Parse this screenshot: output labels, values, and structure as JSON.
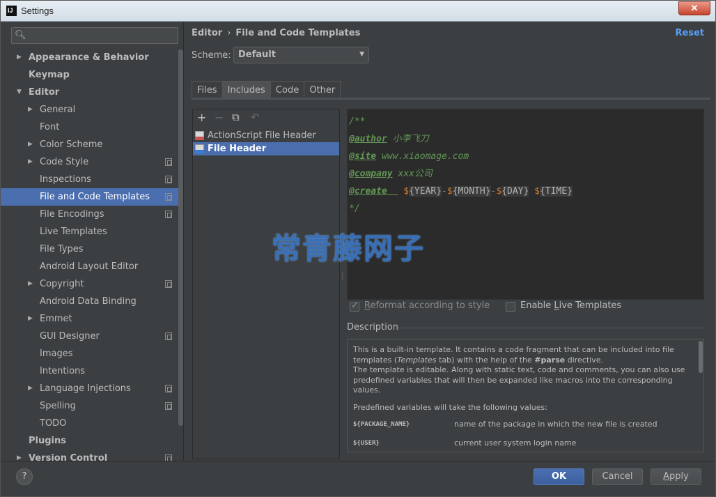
{
  "window": {
    "title": "Settings",
    "app_icon": "IJ",
    "close_label": "✕"
  },
  "search": {
    "placeholder": "",
    "icon": "search-icon"
  },
  "sidebar": {
    "items": [
      {
        "label": "Appearance & Behavior",
        "level": 0,
        "bold": true,
        "arrow": "right",
        "config": false
      },
      {
        "label": "Keymap",
        "level": 0,
        "bold": true,
        "arrow": "none",
        "config": false
      },
      {
        "label": "Editor",
        "level": 0,
        "bold": true,
        "arrow": "down",
        "config": false
      },
      {
        "label": "General",
        "level": 1,
        "arrow": "right",
        "config": false
      },
      {
        "label": "Font",
        "level": 1,
        "arrow": "none",
        "config": false
      },
      {
        "label": "Color Scheme",
        "level": 1,
        "arrow": "right",
        "config": false
      },
      {
        "label": "Code Style",
        "level": 1,
        "arrow": "right",
        "config": true
      },
      {
        "label": "Inspections",
        "level": 1,
        "arrow": "none",
        "config": true
      },
      {
        "label": "File and Code Templates",
        "level": 1,
        "arrow": "none",
        "config": true,
        "selected": true
      },
      {
        "label": "File Encodings",
        "level": 1,
        "arrow": "none",
        "config": true
      },
      {
        "label": "Live Templates",
        "level": 1,
        "arrow": "none",
        "config": false
      },
      {
        "label": "File Types",
        "level": 1,
        "arrow": "none",
        "config": false
      },
      {
        "label": "Android Layout Editor",
        "level": 1,
        "arrow": "none",
        "config": false
      },
      {
        "label": "Copyright",
        "level": 1,
        "arrow": "right",
        "config": true
      },
      {
        "label": "Android Data Binding",
        "level": 1,
        "arrow": "none",
        "config": false
      },
      {
        "label": "Emmet",
        "level": 1,
        "arrow": "right",
        "config": false
      },
      {
        "label": "GUI Designer",
        "level": 1,
        "arrow": "none",
        "config": true
      },
      {
        "label": "Images",
        "level": 1,
        "arrow": "none",
        "config": false
      },
      {
        "label": "Intentions",
        "level": 1,
        "arrow": "none",
        "config": false
      },
      {
        "label": "Language Injections",
        "level": 1,
        "arrow": "right",
        "config": true
      },
      {
        "label": "Spelling",
        "level": 1,
        "arrow": "none",
        "config": true
      },
      {
        "label": "TODO",
        "level": 1,
        "arrow": "none",
        "config": false
      },
      {
        "label": "Plugins",
        "level": 0,
        "bold": true,
        "arrow": "none",
        "config": false
      },
      {
        "label": "Version Control",
        "level": 0,
        "bold": true,
        "arrow": "right",
        "config": true
      }
    ]
  },
  "header": {
    "crumb_parent": "Editor",
    "crumb_sep": "›",
    "crumb_current": "File and Code Templates",
    "reset_label": "Reset"
  },
  "scheme": {
    "label": "Scheme:",
    "value": "Default"
  },
  "tabs": [
    {
      "label": "Files",
      "active": false
    },
    {
      "label": "Includes",
      "active": true
    },
    {
      "label": "Code",
      "active": false
    },
    {
      "label": "Other",
      "active": false
    }
  ],
  "toolbar": {
    "add": "+",
    "remove": "−",
    "copy": "⧉",
    "reset": "↶"
  },
  "templates": [
    {
      "label": "ActionScript File Header",
      "selected": false
    },
    {
      "label": "File Header",
      "selected": true
    }
  ],
  "editor": {
    "line1": "/**",
    "author_tag": "@author",
    "author_value": " 小李飞刀",
    "site_tag": "@site",
    "site_value": " www.xiaomage.com",
    "company_tag": "@company",
    "company_value": " xxx公司",
    "create_tag": "@create",
    "create_gap": "  ",
    "dollar": "$",
    "var_year": "{YEAR}",
    "dash": "-",
    "var_month": "{MONTH}",
    "var_day": "{DAY}",
    "space": " ",
    "var_time": "{TIME}",
    "line_end": "*/"
  },
  "watermark": "常青藤网子",
  "options": {
    "reformat_label_pre": "",
    "reformat_label_u": "R",
    "reformat_label_rest": "eformat according to style",
    "reformat_checked": true,
    "live_label_pre": "Enable ",
    "live_label_u": "L",
    "live_label_rest": "ive Templates",
    "live_checked": false
  },
  "description": {
    "label": "Description",
    "p1_a": "This is a built-in template. It contains a code fragment that can be included into file templates (",
    "p1_em": "Templates",
    "p1_b": " tab) with the help of the ",
    "p1_strong": "#parse",
    "p1_c": " directive.",
    "p2": "The template is editable. Along with static text, code and comments, you can also use predefined variables that will then be expanded like macros into the corresponding values.",
    "p3": "Predefined variables will take the following values:",
    "vars": [
      {
        "name": "${PACKAGE_NAME}",
        "desc": "name of the package in which the new file is created"
      },
      {
        "name": "${USER}",
        "desc": "current user system login name"
      }
    ]
  },
  "footer": {
    "help_label": "?",
    "ok_label": "OK",
    "cancel_label": "Cancel",
    "apply_pre": "",
    "apply_u": "A",
    "apply_rest": "pply"
  },
  "colors": {
    "background": "#3c3f41",
    "editor_bg": "#2b2b2b",
    "selection": "#4b6eaf",
    "comment_green": "#629755",
    "link_blue": "#589df6",
    "watermark_blue": "#3a76c4"
  }
}
